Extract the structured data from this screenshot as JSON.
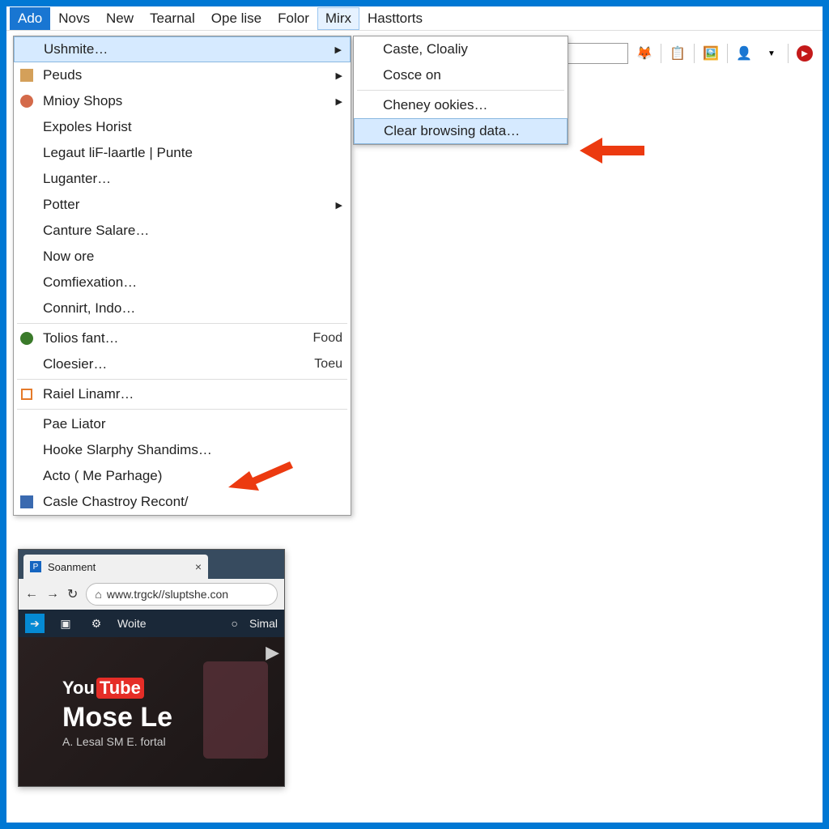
{
  "menubar": {
    "items": [
      {
        "label": "Ado",
        "active": true
      },
      {
        "label": "Novs"
      },
      {
        "label": "New"
      },
      {
        "label": "Tearnal"
      },
      {
        "label": "Ope lise"
      },
      {
        "label": "Folor"
      },
      {
        "label": "Mirx",
        "open": true
      },
      {
        "label": "Hasttorts"
      }
    ]
  },
  "left_menu": {
    "items": [
      {
        "label": "Ushmite…",
        "arrow": true,
        "highlighted": true
      },
      {
        "label": "Peuds",
        "arrow": true,
        "icon": "img"
      },
      {
        "label": "Mnioy Shops",
        "arrow": true,
        "icon": "people"
      },
      {
        "label": "Expoles Horist"
      },
      {
        "label": "Legaut liF-laartle | Punte"
      },
      {
        "label": "Luganter…"
      },
      {
        "label": "Potter",
        "arrow": true
      },
      {
        "label": "Canture Salare…"
      },
      {
        "label": "Now ore"
      },
      {
        "label": "Comfiexation…"
      },
      {
        "label": "Connirt, Indo…"
      },
      {
        "sep": true
      },
      {
        "label": "Tolios fant…",
        "shortcut": "Food",
        "icon": "ball"
      },
      {
        "label": "Cloesier…",
        "shortcut": "Toeu"
      },
      {
        "sep": true
      },
      {
        "label": "Raiel Linamr…",
        "icon": "square"
      },
      {
        "sep": true
      },
      {
        "label": "Pae Liator"
      },
      {
        "label": "Hooke Slarphy Shandims…"
      },
      {
        "label": "Acto ( Me Parhage)"
      },
      {
        "label": "Casle Chastroy Recont/",
        "icon": "win"
      }
    ]
  },
  "right_menu": {
    "items": [
      {
        "label": "Caste, Cloaliy"
      },
      {
        "label": "Cosce on"
      },
      {
        "sep": true
      },
      {
        "label": "Cheney ookies…"
      },
      {
        "label": "Clear browsing data…",
        "highlighted": true
      }
    ]
  },
  "thumb": {
    "tab_title": "Soanment",
    "url": "www.trgck//sluptshe.con",
    "toolbar_label1": "Woite",
    "toolbar_label2": "Simal",
    "yt_you": "You",
    "yt_tube": "Tube",
    "title": "Mose Le",
    "subtitle": "A. Lesal SM E. fortal "
  }
}
